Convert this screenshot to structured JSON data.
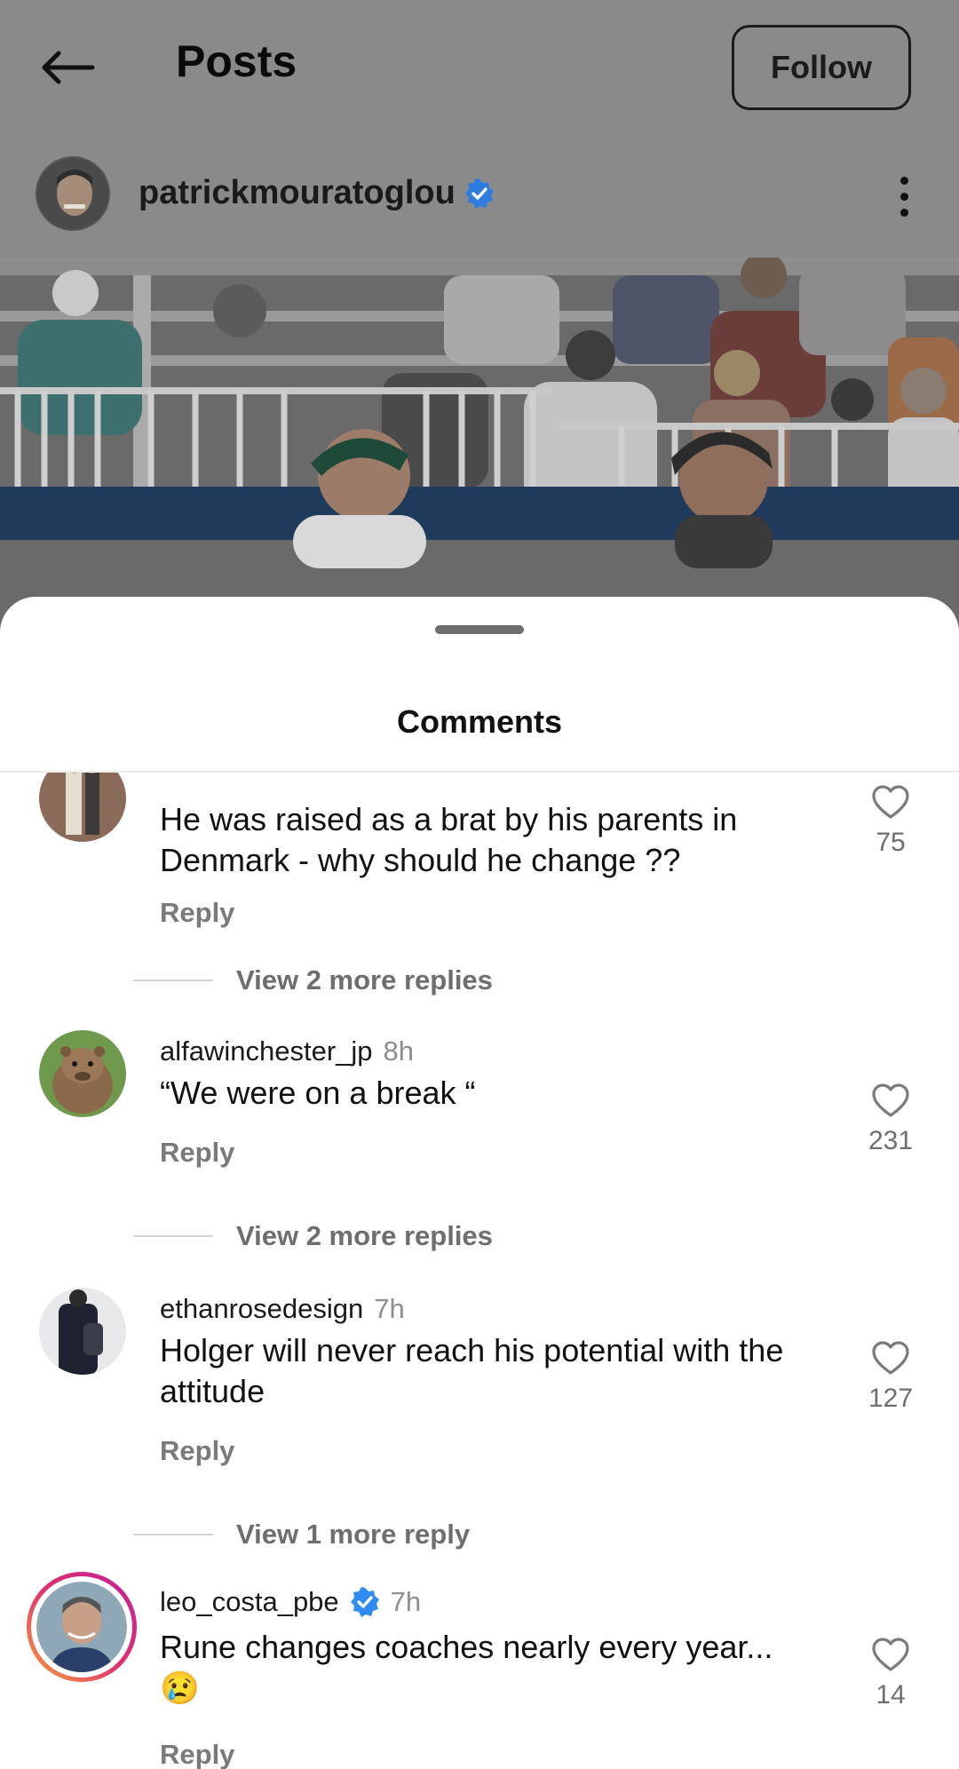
{
  "header": {
    "back_icon": "arrow-left-icon",
    "title": "Posts",
    "follow_label": "Follow"
  },
  "post": {
    "username": "patrickmouratoglou",
    "verified": true,
    "more_icon": "more-vertical-icon"
  },
  "sheet": {
    "title": "Comments"
  },
  "comments": [
    {
      "username": "",
      "time": "",
      "text": "He was raised as a brat by his parents in Denmark - why should he change ??",
      "reply_label": "Reply",
      "likes": "75",
      "view_more": "View 2 more replies"
    },
    {
      "username": "alfawinchester_jp",
      "time": "8h",
      "text": "“We were on a break “",
      "reply_label": "Reply",
      "likes": "231",
      "view_more": "View 2 more replies"
    },
    {
      "username": "ethanrosedesign",
      "time": "7h",
      "text": "Holger will never reach his potential with the attitude",
      "reply_label": "Reply",
      "likes": "127",
      "view_more": "View 1 more reply"
    },
    {
      "username": "leo_costa_pbe",
      "verified": true,
      "time": "7h",
      "text": "Rune changes coaches nearly every year...",
      "emoji": "😢",
      "reply_label": "Reply",
      "likes": "14"
    }
  ],
  "colors": {
    "verified_blue": "#2f8cf1",
    "dim_overlay": "#8a8a8a",
    "story_ring_start": "#f9a23b",
    "story_ring_end": "#c1209b"
  }
}
